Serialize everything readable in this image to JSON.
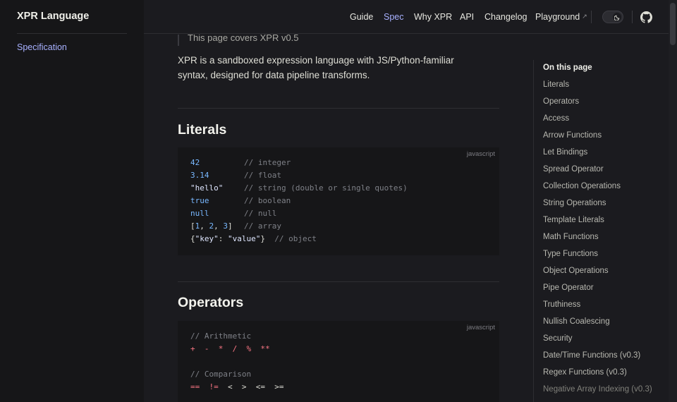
{
  "brand": "XPR Language",
  "sidebar": {
    "items": [
      {
        "label": "Specification"
      }
    ]
  },
  "nav": {
    "items": [
      "Guide",
      "Spec",
      "Why XPR",
      "API",
      "Changelog",
      "Playground"
    ],
    "active": "Spec",
    "external_icon": "↗",
    "theme_toggle_icon": "moon-icon",
    "repo_icon": "github-icon"
  },
  "main": {
    "note": "This page covers XPR v0.5",
    "lead": "XPR is a sandboxed expression language with JS/Python-familiar syntax, designed for data pipeline transforms.",
    "sections": [
      {
        "title": "Literals",
        "lang": "javascript",
        "lines": [
          [
            {
              "t": "42",
              "c": "num"
            },
            {
              "t": "// integer",
              "c": "cm",
              "pos": true
            }
          ],
          [
            {
              "t": "3.14",
              "c": "num"
            },
            {
              "t": "// float",
              "c": "cm",
              "pos": true
            }
          ],
          [
            {
              "t": "\"hello\"",
              "c": "str"
            },
            {
              "t": "// string (double or single quotes)",
              "c": "cm",
              "pos": true
            }
          ],
          [
            {
              "t": "true",
              "c": "kw"
            },
            {
              "t": "// boolean",
              "c": "cm",
              "pos": true
            }
          ],
          [
            {
              "t": "null",
              "c": "kw"
            },
            {
              "t": "// null",
              "c": "cm",
              "pos": true
            }
          ],
          [
            {
              "t": "[",
              "c": "pl"
            },
            {
              "t": "1",
              "c": "num"
            },
            {
              "t": ", ",
              "c": "pl"
            },
            {
              "t": "2",
              "c": "num"
            },
            {
              "t": ", ",
              "c": "pl"
            },
            {
              "t": "3",
              "c": "num"
            },
            {
              "t": "]",
              "c": "pl"
            },
            {
              "t": "// array",
              "c": "cm",
              "pos": true
            }
          ],
          [
            {
              "t": "{",
              "c": "pl"
            },
            {
              "t": "\"key\"",
              "c": "str"
            },
            {
              "t": ": ",
              "c": "pl"
            },
            {
              "t": "\"value\"",
              "c": "str"
            },
            {
              "t": "}  ",
              "c": "pl"
            },
            {
              "t": "// object",
              "c": "cm"
            }
          ]
        ]
      },
      {
        "title": "Operators",
        "lang": "javascript",
        "lines": [
          [
            {
              "t": "// Arithmetic",
              "c": "cm"
            }
          ],
          [
            {
              "t": "+  -  *  /  %  **",
              "c": "op"
            }
          ],
          [],
          [
            {
              "t": "// Comparison",
              "c": "cm"
            }
          ],
          [
            {
              "t": "==  !=",
              "c": "op"
            },
            {
              "t": "  <  >  <=  >=",
              "c": "pl"
            }
          ]
        ]
      }
    ]
  },
  "aside": {
    "title": "On this page",
    "items": [
      "Literals",
      "Operators",
      "Access",
      "Arrow Functions",
      "Let Bindings",
      "Spread Operator",
      "Collection Operations",
      "String Operations",
      "Template Literals",
      "Math Functions",
      "Type Functions",
      "Object Operations",
      "Pipe Operator",
      "Truthiness",
      "Nullish Coalescing",
      "Security",
      "Date/Time Functions (v0.3)",
      "Regex Functions (v0.3)",
      "Negative Array Indexing (v0.3)"
    ]
  }
}
